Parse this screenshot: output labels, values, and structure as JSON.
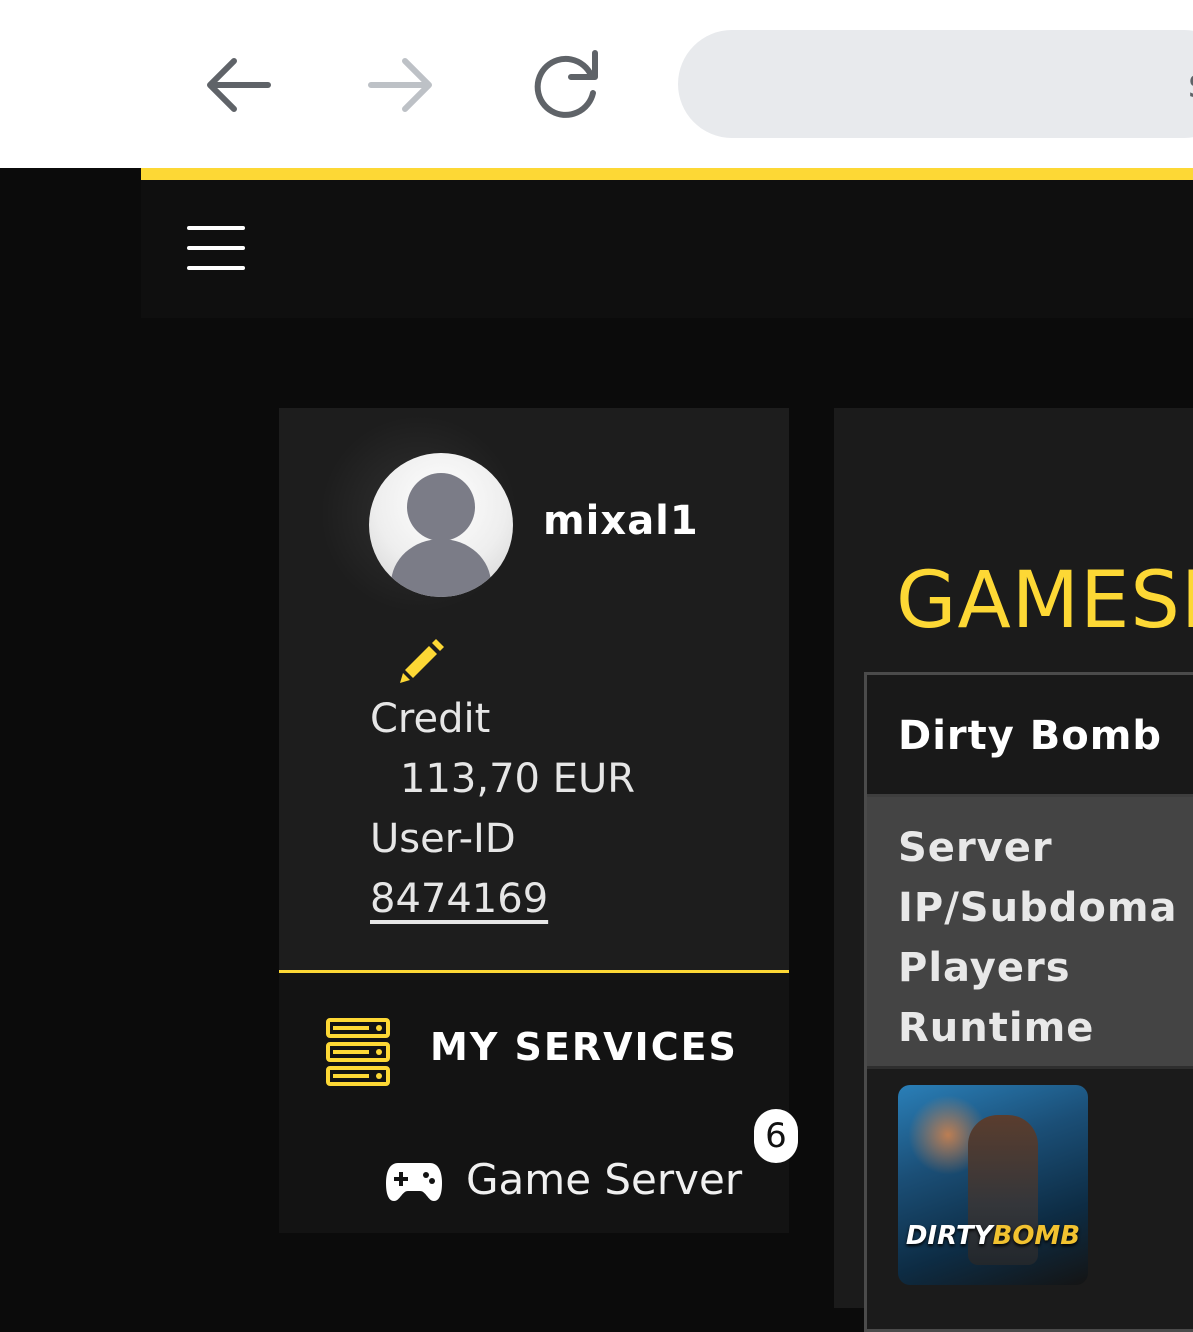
{
  "browser": {
    "back_label": "Back",
    "forward_label": "Forward",
    "reload_label": "Reload",
    "address_text": "s"
  },
  "colors": {
    "accent": "#fdd835",
    "background": "#0b0b0b",
    "card": "#1d1d1d"
  },
  "profile": {
    "username": "mixal1",
    "credit_label": "Credit",
    "credit_value": "113,70 EUR",
    "userid_label": "User-ID",
    "userid_value": "8474169"
  },
  "services": {
    "title": "MY SERVICES",
    "items": [
      {
        "label": "Game Server",
        "count": "6",
        "icon": "gamepad-icon"
      }
    ]
  },
  "main": {
    "title": "GAMESE",
    "server_card": {
      "game_name": "Dirty Bomb",
      "fields": [
        "Server",
        "IP/Subdoma",
        "Players",
        "Runtime"
      ],
      "thumbnail_logo_part1": "DIRTY",
      "thumbnail_logo_part2": "BOMB"
    }
  }
}
